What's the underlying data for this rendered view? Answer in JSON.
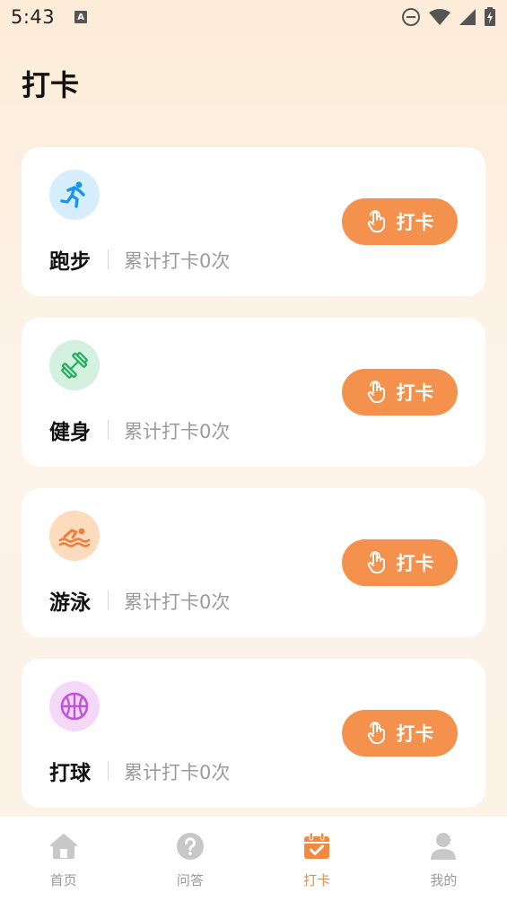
{
  "status": {
    "time": "5:43",
    "a_badge": "A"
  },
  "header": {
    "title": "打卡"
  },
  "checkin_button_label": "打卡",
  "cards": [
    {
      "name": "跑步",
      "count_text": "累计打卡0次",
      "icon": "running-icon",
      "icon_bg": "#d6eefc",
      "icon_color": "#1b96e6"
    },
    {
      "name": "健身",
      "count_text": "累计打卡0次",
      "icon": "dumbbell-icon",
      "icon_bg": "#d4f1e0",
      "icon_color": "#1fae5c"
    },
    {
      "name": "游泳",
      "count_text": "累计打卡0次",
      "icon": "swimming-icon",
      "icon_bg": "#fddcbd",
      "icon_color": "#ef7e3a"
    },
    {
      "name": "打球",
      "count_text": "累计打卡0次",
      "icon": "basketball-icon",
      "icon_bg": "#f4d8f8",
      "icon_color": "#c052e0"
    }
  ],
  "bottom_nav": [
    {
      "label": "首页",
      "icon": "home-icon",
      "active": false
    },
    {
      "label": "问答",
      "icon": "question-icon",
      "active": false
    },
    {
      "label": "打卡",
      "icon": "calendar-check-icon",
      "active": true
    },
    {
      "label": "我的",
      "icon": "user-icon",
      "active": false
    }
  ],
  "colors": {
    "accent": "#f3914d",
    "nav_active": "#f08a3f",
    "nav_inactive": "#c8c8c8"
  }
}
